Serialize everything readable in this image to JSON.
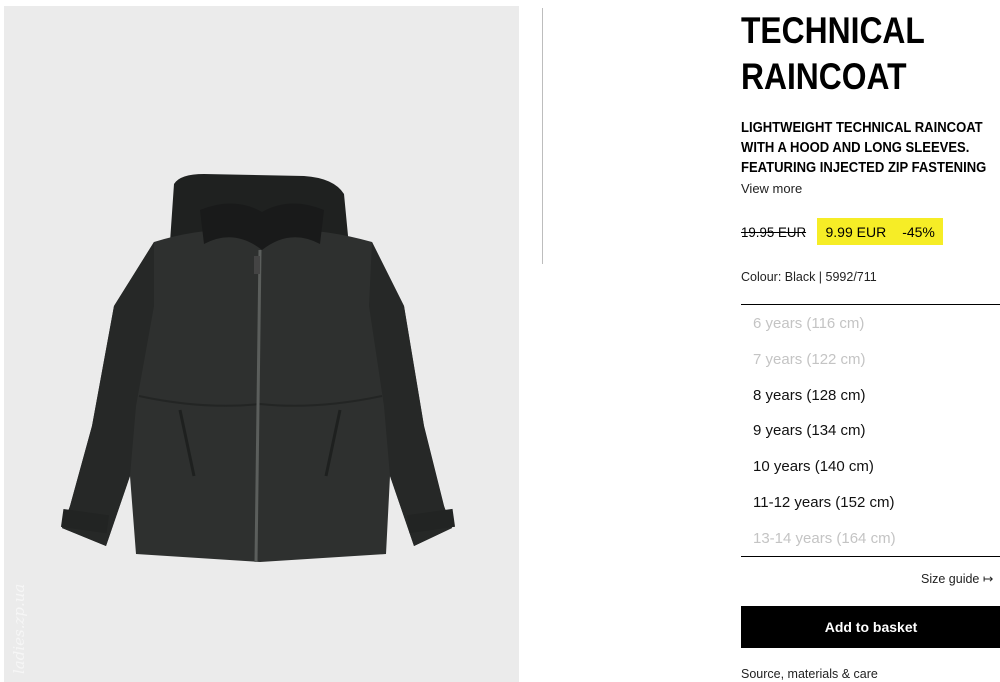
{
  "product": {
    "title_line1": "TECHNICAL",
    "title_line2": "RAINCOAT",
    "description_lines": [
      "LIGHTWEIGHT TECHNICAL RAINCOAT",
      "WITH A HOOD AND LONG SLEEVES.",
      "FEATURING INJECTED ZIP FASTENING"
    ],
    "view_more": "View more",
    "old_price": "19.95 EUR",
    "new_price": "9.99 EUR",
    "discount": "-45%",
    "colour": "Colour: Black | 5992/711"
  },
  "sizes": [
    {
      "label": "6 years (116 cm)",
      "available": false
    },
    {
      "label": "7 years (122 cm)",
      "available": false
    },
    {
      "label": "8 years (128 cm)",
      "available": true
    },
    {
      "label": "9 years (134 cm)",
      "available": true
    },
    {
      "label": "10 years (140 cm)",
      "available": true
    },
    {
      "label": "11-12 years (152 cm)",
      "available": true
    },
    {
      "label": "13-14 years (164 cm)",
      "available": false
    }
  ],
  "size_guide": "Size guide ↦",
  "add_to_basket": "Add to basket",
  "source_care": "Source, materials & care",
  "watermark": "ladies.zp.ua",
  "colors": {
    "sale_highlight": "#f6ed26",
    "jacket": "#2e302f",
    "photo_bg": "#ebebeb"
  }
}
